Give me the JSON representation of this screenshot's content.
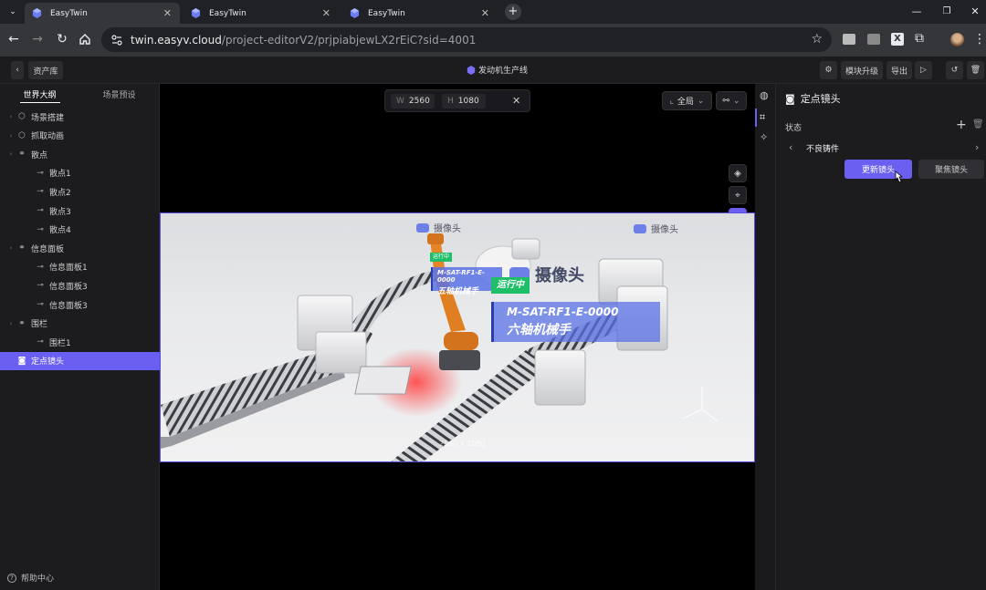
{
  "browser": {
    "tabs": [
      {
        "title": "EasyTwin",
        "active": true
      },
      {
        "title": "EasyTwin",
        "active": false
      },
      {
        "title": "EasyTwin",
        "active": false
      }
    ],
    "url_host": "twin.easyv.cloud",
    "url_path": "/project-editorV2/prjpiabjewLX2rEiC?sid=4001"
  },
  "header": {
    "back_label": "资产库",
    "project_title": "发动机生产线",
    "module_upgrade": "模块升级",
    "export": "导出"
  },
  "left_panel": {
    "tabs": [
      "世界大纲",
      "场景预设"
    ],
    "tree": [
      {
        "label": "场景搭建",
        "level": 0,
        "icon": "cube-icon"
      },
      {
        "label": "抓取动画",
        "level": 0,
        "icon": "cube-icon"
      },
      {
        "label": "散点",
        "level": 0,
        "icon": "group-icon"
      },
      {
        "label": "散点1",
        "level": 1,
        "icon": "link-icon"
      },
      {
        "label": "散点2",
        "level": 1,
        "icon": "link-icon"
      },
      {
        "label": "散点3",
        "level": 1,
        "icon": "link-icon"
      },
      {
        "label": "散点4",
        "level": 1,
        "icon": "link-icon"
      },
      {
        "label": "信息面板",
        "level": 0,
        "icon": "group-icon"
      },
      {
        "label": "信息面板1",
        "level": 1,
        "icon": "link-icon"
      },
      {
        "label": "信息面板3",
        "level": 1,
        "icon": "link-icon"
      },
      {
        "label": "信息面板3",
        "level": 1,
        "icon": "link-icon"
      },
      {
        "label": "围栏",
        "level": 0,
        "icon": "group-icon"
      },
      {
        "label": "围栏1",
        "level": 1,
        "icon": "link-icon"
      },
      {
        "label": "定点镜头",
        "level": 0,
        "icon": "camera-icon",
        "selected": true
      }
    ],
    "help": "帮助中心"
  },
  "viewport": {
    "width_label": "W",
    "width_value": "2560",
    "height_label": "H",
    "height_value": "1080",
    "view_mode": "全局",
    "scene_labels": {
      "camera1": "摄像头",
      "camera2": "摄像头",
      "camera_big": "摄像头",
      "tag_running_small": "运行中",
      "device_small_id": "M-SAT-RF1-E-0000",
      "device_small_name": "五轴机械手",
      "tag_running": "运行中",
      "device_big_id": "M-SAT-RF1-E-0000",
      "device_big_name": "六轴机械手",
      "resolution_watermark": "2560 x 1080"
    }
  },
  "right_panel": {
    "title": "定点镜头",
    "state_label": "状态",
    "state_value": "不良铸件",
    "update_button": "更新镜头",
    "focus_button": "聚焦镜头"
  },
  "colors": {
    "accent": "#6a5ff0",
    "running_green": "#1fbf6a",
    "panel_blue": "#5a72e6"
  }
}
